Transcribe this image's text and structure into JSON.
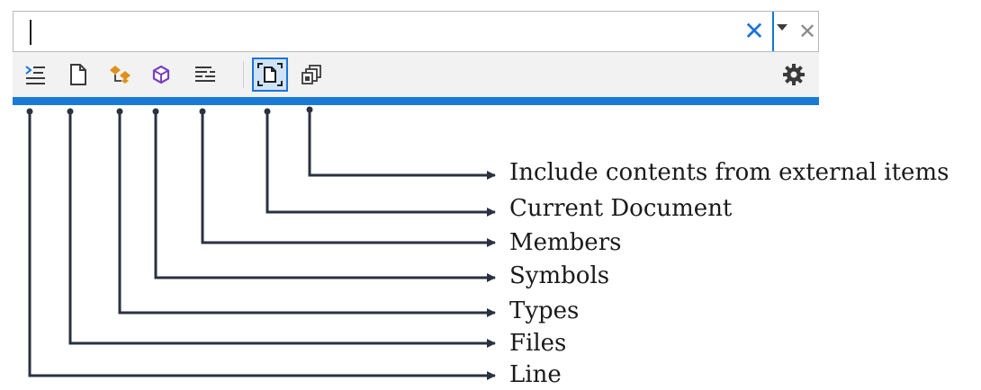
{
  "search": {
    "value": "",
    "clear_icon": "close-x-icon",
    "dropdown_icon": "chevron-down-icon",
    "close_icon": "close-icon"
  },
  "toolbar": {
    "items": [
      {
        "name": "line",
        "icon": "line-filter-icon"
      },
      {
        "name": "files",
        "icon": "file-icon"
      },
      {
        "name": "types",
        "icon": "types-icon"
      },
      {
        "name": "symbols",
        "icon": "cube-icon"
      },
      {
        "name": "members",
        "icon": "members-icon"
      },
      {
        "name": "current-document",
        "icon": "current-document-icon",
        "active": true
      },
      {
        "name": "external-items",
        "icon": "external-items-icon"
      }
    ],
    "settings_icon": "gear-icon"
  },
  "callouts": {
    "external_items": "Include contents from external items",
    "current_document": "Current Document",
    "members": "Members",
    "symbols": "Symbols",
    "types": "Types",
    "files": "Files",
    "line": "Line"
  },
  "colors": {
    "accent": "#1b74d8",
    "bar": "#1b7ad6",
    "toolbar_bg": "#f2f2f2",
    "types_orange": "#e0901a",
    "symbols_purple": "#7a3fbf",
    "arrow": "#2a3240"
  }
}
